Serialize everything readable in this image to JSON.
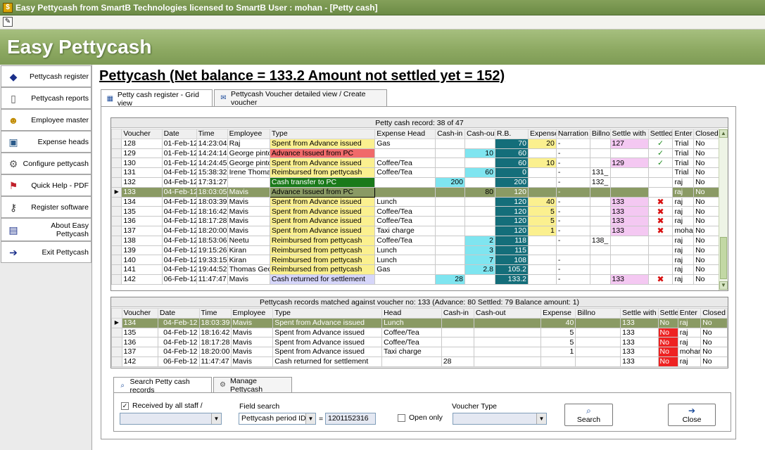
{
  "window": {
    "title": "Easy Pettycash from SmartB Technologies  licensed to SmartB     User : mohan - [Petty cash]",
    "app_icon": "dollar-icon",
    "banner_title": "Easy Pettycash"
  },
  "sidebar": {
    "items": [
      {
        "label": "Pettycash register",
        "icon": "book-icon"
      },
      {
        "label": "Pettycash reports",
        "icon": "page-icon"
      },
      {
        "label": "Employee master",
        "icon": "people-icon"
      },
      {
        "label": "Expense heads",
        "icon": "folder-icon"
      },
      {
        "label": "Configure pettycash",
        "icon": "gear-icon"
      },
      {
        "label": "Quick Help - PDF",
        "icon": "pdf-icon"
      },
      {
        "label": "Register software",
        "icon": "key-icon"
      },
      {
        "label": "About Easy Pettycash",
        "icon": "info-icon"
      },
      {
        "label": "Exit  Pettycash",
        "icon": "exit-icon"
      }
    ]
  },
  "heading": "Pettycash (Net balance = 133.2  Amount not settled yet = 152)",
  "tabs": [
    {
      "label": "Petty cash register - Grid view",
      "icon": "grid-icon"
    },
    {
      "label": "Pettycash Voucher detailed view / Create voucher",
      "icon": "voucher-icon"
    }
  ],
  "grid1": {
    "caption": "Petty cash record: 38 of 47",
    "columns": [
      "Voucher",
      "Date",
      "Time",
      "Employee",
      "Type",
      "Expense Head",
      "Cash-in",
      "Cash-out",
      "R.B.",
      "Expense",
      "Narration",
      "Billno",
      "Settle with",
      "Settled",
      "Enter",
      "Closed"
    ],
    "rows": [
      [
        "128",
        "01-Feb-12",
        "14:23:04",
        "Raj",
        "Spent from Advance issued",
        "Gas",
        "",
        "",
        "70",
        "20",
        "-",
        "",
        "127",
        "check",
        "Trial",
        "No"
      ],
      [
        "129",
        "01-Feb-12",
        "14:24:14",
        "George pinto",
        "Advance Issued from PC",
        "",
        "",
        "10",
        "60",
        "",
        "-",
        "",
        "",
        "check",
        "Trial",
        "No"
      ],
      [
        "130",
        "01-Feb-12",
        "14:24:45",
        "George pinto",
        "Spent from Advance issued",
        "Coffee/Tea",
        "",
        "",
        "60",
        "10",
        "-",
        "",
        "129",
        "check",
        "Trial",
        "No"
      ],
      [
        "131",
        "04-Feb-12",
        "15:38:32",
        "Irene Thomas",
        "Reimbursed from pettycash",
        "Coffee/Tea",
        "",
        "60",
        "0",
        "",
        "-",
        "131_",
        "",
        "",
        "Trial",
        "No"
      ],
      [
        "132",
        "04-Feb-12",
        "17:31:27",
        "",
        "Cash transfer to PC",
        "",
        "200",
        "",
        "200",
        "",
        "-",
        "132_",
        "",
        "",
        "raj",
        "No"
      ],
      [
        "133",
        "04-Feb-12",
        "18:03:05",
        "Mavis",
        "Advance Issued from PC",
        "",
        "",
        "80",
        "120",
        "",
        "-",
        "",
        "",
        "cross",
        "raj",
        "No"
      ],
      [
        "134",
        "04-Feb-12",
        "18:03:39",
        "Mavis",
        "Spent from Advance issued",
        "Lunch",
        "",
        "",
        "120",
        "40",
        "-",
        "",
        "133",
        "cross",
        "raj",
        "No"
      ],
      [
        "135",
        "04-Feb-12",
        "18:16:42",
        "Mavis",
        "Spent from Advance issued",
        "Coffee/Tea",
        "",
        "",
        "120",
        "5",
        "-",
        "",
        "133",
        "cross",
        "raj",
        "No"
      ],
      [
        "136",
        "04-Feb-12",
        "18:17:28",
        "Mavis",
        "Spent from Advance issued",
        "Coffee/Tea",
        "",
        "",
        "120",
        "5",
        "-",
        "",
        "133",
        "cross",
        "raj",
        "No"
      ],
      [
        "137",
        "04-Feb-12",
        "18:20:00",
        "Mavis",
        "Spent from Advance issued",
        "Taxi charge",
        "",
        "",
        "120",
        "1",
        "-",
        "",
        "133",
        "cross",
        "mohan",
        "No"
      ],
      [
        "138",
        "04-Feb-12",
        "18:53:06",
        "Neetu",
        "Reimbursed from pettycash",
        "Coffee/Tea",
        "",
        "2",
        "118",
        "",
        "-",
        "138_",
        "",
        "",
        "raj",
        "No"
      ],
      [
        "139",
        "04-Feb-12",
        "19:15:26",
        "Kiran",
        "Reimbursed from pettycash",
        "Lunch",
        "",
        "3",
        "115",
        "",
        "",
        "",
        "",
        "",
        "raj",
        "No"
      ],
      [
        "140",
        "04-Feb-12",
        "19:33:15",
        "Kiran",
        "Reimbursed from pettycash",
        "Lunch",
        "",
        "7",
        "108",
        "",
        "-",
        "",
        "",
        "",
        "raj",
        "No"
      ],
      [
        "141",
        "04-Feb-12",
        "19:44:52",
        "Thomas George",
        "Reimbursed from pettycash",
        "Gas",
        "",
        "2.8",
        "105.2",
        "",
        "-",
        "",
        "",
        "",
        "raj",
        "No"
      ],
      [
        "142",
        "06-Feb-12",
        "11:47:47",
        "Mavis",
        "Cash returned for settlement",
        "",
        "28",
        "",
        "133.2",
        "",
        "-",
        "",
        "133",
        "cross",
        "raj",
        "No"
      ]
    ],
    "selected_index": 5
  },
  "grid2": {
    "caption": "Pettycash records matched against voucher no: 133  (Advance: 80   Settled: 79 Balance amount: 1)",
    "columns": [
      "Voucher",
      "Date",
      "Time",
      "Employee",
      "Type",
      "Head",
      "Cash-in",
      "Cash-out",
      "Expense",
      "Billno",
      "Settle with",
      "Settled",
      "Enter",
      "Closed"
    ],
    "rows": [
      [
        "134",
        "04-Feb-12",
        "18:03:39",
        "Mavis",
        "Spent from Advance issued",
        "Lunch",
        "",
        "",
        "40",
        "",
        "133",
        "No",
        "raj",
        "No"
      ],
      [
        "135",
        "04-Feb-12",
        "18:16:42",
        "Mavis",
        "Spent from Advance issued",
        "Coffee/Tea",
        "",
        "",
        "5",
        "",
        "133",
        "No",
        "raj",
        "No"
      ],
      [
        "136",
        "04-Feb-12",
        "18:17:28",
        "Mavis",
        "Spent from Advance issued",
        "Coffee/Tea",
        "",
        "",
        "5",
        "",
        "133",
        "No",
        "raj",
        "No"
      ],
      [
        "137",
        "04-Feb-12",
        "18:20:00",
        "Mavis",
        "Spent from Advance issued",
        "Taxi charge",
        "",
        "",
        "1",
        "",
        "133",
        "No",
        "mohan",
        "No"
      ],
      [
        "142",
        "06-Feb-12",
        "11:47:47",
        "Mavis",
        "Cash returned for settlement",
        "",
        "28",
        "",
        "",
        "",
        "133",
        "No",
        "raj",
        "No"
      ]
    ],
    "selected_index": 0
  },
  "bottom_tabs": [
    {
      "label": "Search Petty cash records",
      "icon": "search-icon"
    },
    {
      "label": "Manage Pettycash",
      "icon": "gear-icon"
    }
  ],
  "search": {
    "received_label": "Received by all staff /",
    "received_checked": true,
    "field_search_label": "Field search",
    "field_search_value": "Pettycash period ID",
    "equals": "=",
    "field_value": "1201152316",
    "open_only_label": "Open only",
    "open_only_checked": false,
    "voucher_type_label": "Voucher Type",
    "search_button": "Search",
    "close_button": "Close"
  },
  "colors": {
    "banner": "#8eaa63",
    "rb_cell": "#146e7a",
    "selected_row": "#8a9a64",
    "advance_pc": "#f06a6a",
    "spent_yellow": "#fbf08f",
    "transfer_green": "#1a7a1a",
    "returned_lavender": "#d6d6fa",
    "cash_cyan": "#7fe5f0",
    "settle_pink": "#f4c8f2",
    "not_settled_red": "#ee2222"
  }
}
